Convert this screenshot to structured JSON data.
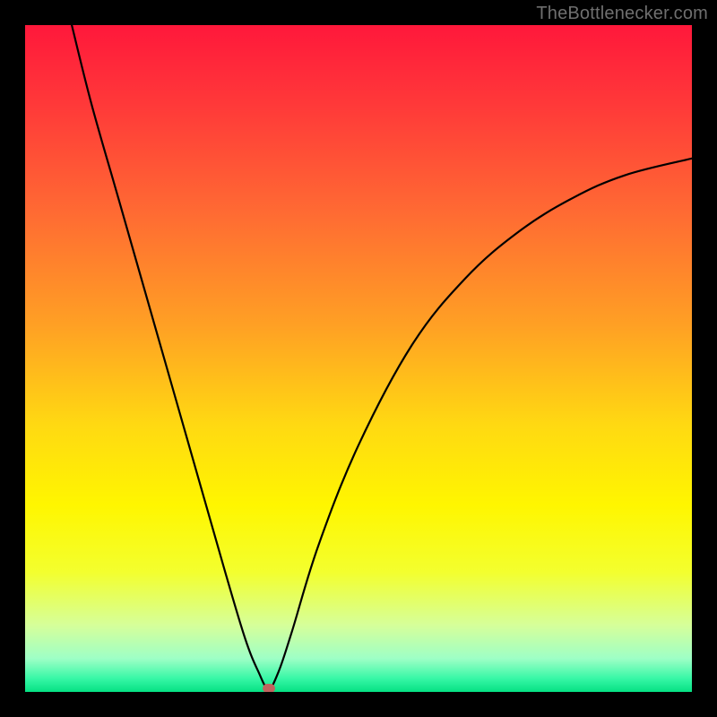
{
  "watermark": {
    "text": "TheBottlenecker.com"
  },
  "chart_data": {
    "type": "line",
    "title": "",
    "xlabel": "",
    "ylabel": "",
    "xlim": [
      0,
      100
    ],
    "ylim": [
      0,
      100
    ],
    "axes_visible": false,
    "grid": false,
    "background_gradient_stops": [
      {
        "pct": 0,
        "color": "#ff183b"
      },
      {
        "pct": 12,
        "color": "#ff3939"
      },
      {
        "pct": 28,
        "color": "#ff6a33"
      },
      {
        "pct": 45,
        "color": "#ffa024"
      },
      {
        "pct": 60,
        "color": "#ffd912"
      },
      {
        "pct": 72,
        "color": "#fff600"
      },
      {
        "pct": 82,
        "color": "#f3ff2e"
      },
      {
        "pct": 90,
        "color": "#d6ff9a"
      },
      {
        "pct": 95,
        "color": "#9effc6"
      },
      {
        "pct": 98,
        "color": "#37f7a6"
      },
      {
        "pct": 100,
        "color": "#05e183"
      }
    ],
    "series": [
      {
        "name": "bottleneck-curve",
        "x": [
          7,
          10,
          14,
          18,
          22,
          26,
          30,
          33,
          35,
          36.5,
          38,
          40,
          44,
          50,
          58,
          66,
          74,
          82,
          90,
          100
        ],
        "y": [
          100,
          88,
          74,
          60,
          46,
          32,
          18,
          8,
          3,
          0.5,
          3,
          9,
          22,
          37,
          52,
          62,
          69,
          74,
          77.5,
          80
        ]
      }
    ],
    "marker": {
      "x": 36.5,
      "y": 0.5,
      "label": "optimal-point"
    }
  }
}
